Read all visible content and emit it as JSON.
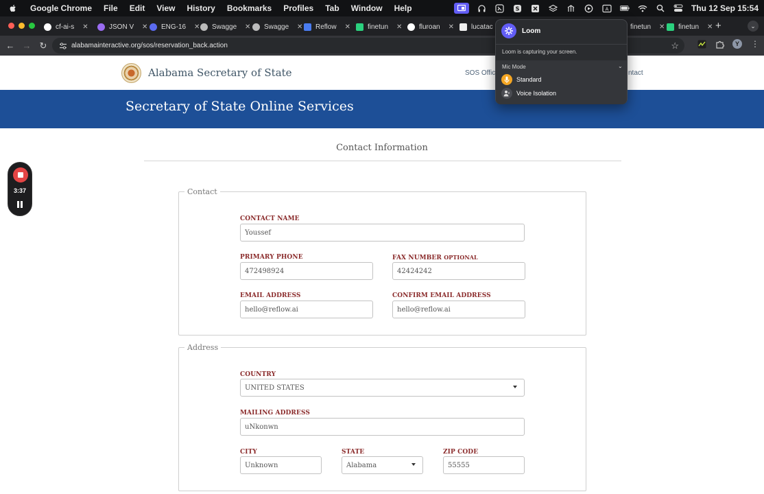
{
  "menubar": {
    "app_name": "Google Chrome",
    "menus": [
      "File",
      "Edit",
      "View",
      "History",
      "Bookmarks",
      "Profiles",
      "Tab",
      "Window",
      "Help"
    ],
    "clock": "Thu 12 Sep  15:54"
  },
  "browser": {
    "tabs": [
      {
        "title": "cf-ai-s",
        "color": "#ffffff"
      },
      {
        "title": "JSON V",
        "color": "#9a6cf2"
      },
      {
        "title": "ENG-16",
        "color": "#5b6bf0"
      },
      {
        "title": "Swagge",
        "color": "#bbbbbb"
      },
      {
        "title": "Swagge",
        "color": "#bbbbbb"
      },
      {
        "title": "Reflow",
        "color": "#4a7cf0"
      },
      {
        "title": "finetun",
        "color": "#2bd17e"
      },
      {
        "title": "fluroan",
        "color": "#ffffff"
      },
      {
        "title": "lucatac",
        "color": "#eeeeee"
      },
      {
        "title": "finetun",
        "color": "#2bd17e"
      },
      {
        "title": "finetun",
        "color": "#2bd17e"
      }
    ],
    "url": "alabamainteractive.org/sos/reservation_back.action",
    "profile_initial": "Y"
  },
  "site": {
    "name": "Alabama Secretary of State",
    "nav_partial_left": "SOS Offic",
    "nav_partial_right": "ntact",
    "banner_title": "Secretary of State Online Services",
    "section_title": "Contact Information"
  },
  "contact": {
    "legend": "Contact",
    "name_label": "CONTACT NAME",
    "name_value": "Youssef",
    "phone_label": "PRIMARY PHONE",
    "phone_value": "472498924",
    "fax_label": "FAX NUMBER",
    "fax_optional": "OPTIONAL",
    "fax_value": "42424242",
    "email_label": "EMAIL ADDRESS",
    "email_value": "hello@reflow.ai",
    "confirm_email_label": "CONFIRM EMAIL ADDRESS",
    "confirm_email_value": "hello@reflow.ai"
  },
  "address": {
    "legend": "Address",
    "country_label": "COUNTRY",
    "country_value": "UNITED STATES",
    "mailing_label": "MAILING ADDRESS",
    "mailing_value": "uNkonwn",
    "city_label": "CITY",
    "city_value": "Unknown",
    "state_label": "STATE",
    "state_value": "Alabama",
    "zip_label": "ZIP CODE",
    "zip_value": "55555"
  },
  "loom_recorder": {
    "time": "3:37"
  },
  "loom_popover": {
    "title": "Loom",
    "status": "Loom is capturing your screen.",
    "mic_mode_label": "Mic Mode",
    "options": [
      "Standard",
      "Voice Isolation"
    ],
    "accent": "#625df5"
  }
}
